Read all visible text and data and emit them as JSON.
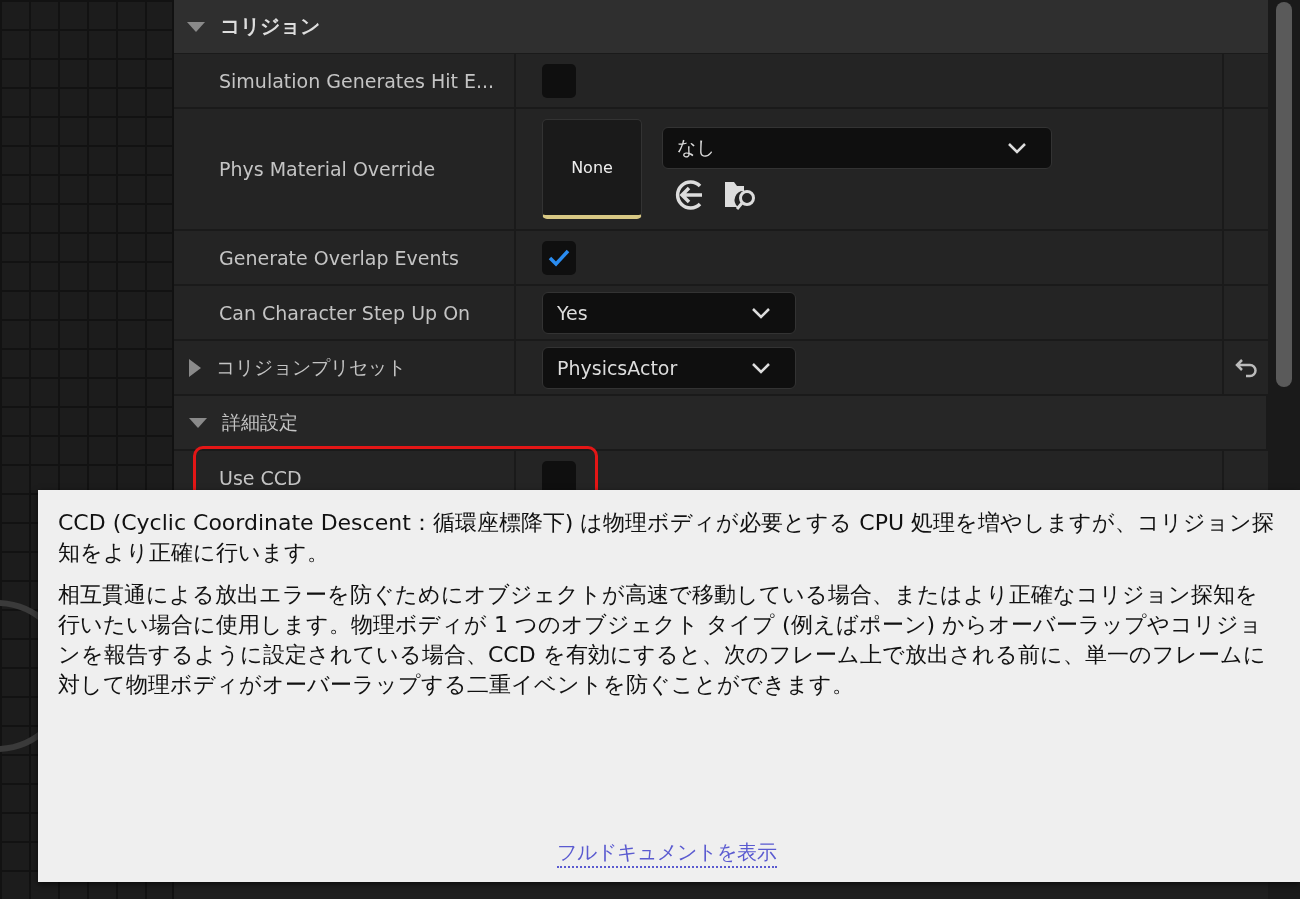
{
  "section": {
    "title": "コリジョン",
    "expanded": true
  },
  "rows": [
    {
      "kind": "checkbox",
      "label": "Simulation Generates Hit E...",
      "checked": false
    },
    {
      "kind": "asset",
      "label": "Phys Material Override",
      "thumbnail": "None",
      "value": "なし"
    },
    {
      "kind": "checkbox",
      "label": "Generate Overlap Events",
      "checked": true
    },
    {
      "kind": "dropdown",
      "label": "Can Character Step Up On",
      "value": "Yes"
    },
    {
      "kind": "group",
      "label": "コリジョンプリセット",
      "expanded": false,
      "value": "PhysicsActor",
      "reset": true
    },
    {
      "kind": "subheader",
      "label": "詳細設定",
      "expanded": true
    },
    {
      "kind": "checkbox",
      "label": "Use CCD",
      "checked": false,
      "highlighted": true
    }
  ],
  "tooltip": {
    "paragraphs": [
      "CCD (Cyclic Coordinate Descent：循環座標降下) は物理ボディが必要とする CPU 処理を増やしますが、コリジョン探知をより正確に行います。",
      "相互貫通による放出エラーを防ぐためにオブジェクトが高速で移動している場合、またはより正確なコリジョン探知を行いたい場合に使用します。物理ボディが 1 つのオブジェクト タイプ (例えばポーン) からオーバーラップやコリジョンを報告するように設定されている場合、CCD を有効にすると、次のフレーム上で放出される前に、単一のフレームに対して物理ボディがオーバーラップする二重イベントを防ぐことができます。"
    ],
    "link": "フルドキュメントを表示"
  }
}
